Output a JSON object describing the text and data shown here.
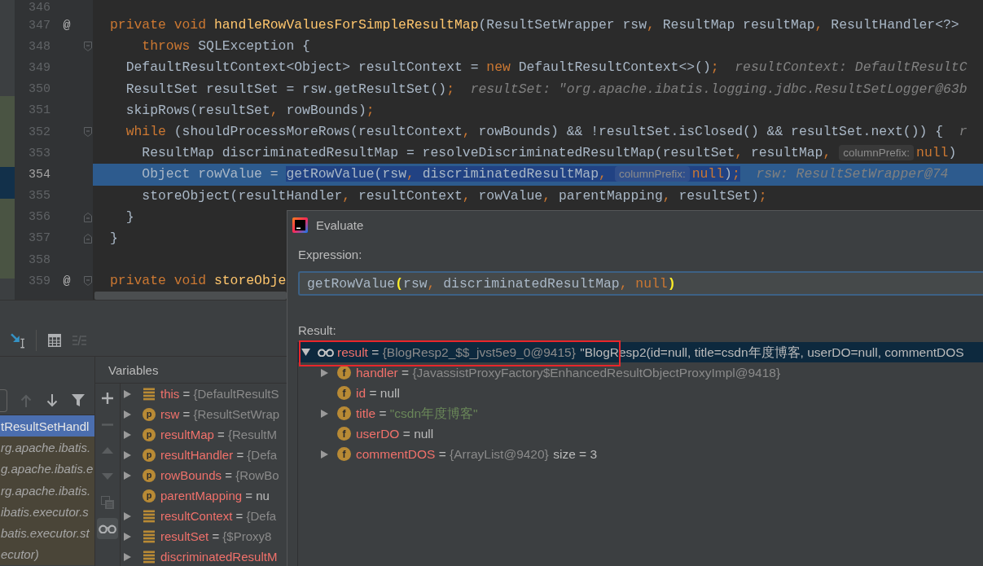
{
  "editor": {
    "lines": [
      {
        "number": "346",
        "current": false,
        "fold_start": false,
        "fold_end": false
      },
      {
        "number": "347",
        "gutter_mark": "@",
        "current": false,
        "fold_start": false,
        "fold_end": false,
        "tokens": [
          {
            "kind": "keyword",
            "text": "private void "
          },
          {
            "kind": "method",
            "text": "handleRowValuesForSimpleResultMap"
          },
          {
            "kind": "plain",
            "text": "(ResultSetWrapper rsw"
          },
          {
            "kind": "punct",
            "text": ","
          },
          {
            "kind": "plain",
            "text": " ResultMap resultMap"
          },
          {
            "kind": "punct",
            "text": ","
          },
          {
            "kind": "plain",
            "text": " ResultHandler<?>"
          }
        ]
      },
      {
        "number": "348",
        "current": false,
        "fold_start": true,
        "fold_end": false,
        "tokens": [
          {
            "kind": "keyword",
            "text": "    throws"
          },
          {
            "kind": "plain",
            "text": " SQLException {"
          }
        ]
      },
      {
        "number": "349",
        "current": false,
        "fold_start": false,
        "fold_end": false,
        "tokens": [
          {
            "kind": "plain",
            "text": "  DefaultResultContext<Object> resultContext = "
          },
          {
            "kind": "keyword",
            "text": "new"
          },
          {
            "kind": "plain",
            "text": " DefaultResultContext<>()"
          },
          {
            "kind": "punct",
            "text": ";"
          },
          {
            "kind": "hint",
            "text": "resultContext: DefaultResultC"
          }
        ]
      },
      {
        "number": "350",
        "current": false,
        "fold_start": false,
        "fold_end": false,
        "tokens": [
          {
            "kind": "plain",
            "text": "  ResultSet resultSet = rsw.getResultSet()"
          },
          {
            "kind": "punct",
            "text": ";"
          },
          {
            "kind": "hint",
            "text": "resultSet: \"org.apache.ibatis.logging.jdbc.ResultSetLogger@63b"
          }
        ]
      },
      {
        "number": "351",
        "current": false,
        "fold_start": false,
        "fold_end": false,
        "tokens": [
          {
            "kind": "plain",
            "text": "  skipRows(resultSet"
          },
          {
            "kind": "punct",
            "text": ","
          },
          {
            "kind": "plain",
            "text": " rowBounds)"
          },
          {
            "kind": "punct",
            "text": ";"
          }
        ]
      },
      {
        "number": "352",
        "current": false,
        "fold_start": true,
        "fold_end": false,
        "tokens": [
          {
            "kind": "keyword",
            "text": "  while"
          },
          {
            "kind": "plain",
            "text": " (shouldProcessMoreRows(resultContext"
          },
          {
            "kind": "punct",
            "text": ","
          },
          {
            "kind": "plain",
            "text": " rowBounds) && !resultSet.isClosed() && resultSet.next()) {"
          },
          {
            "kind": "hint",
            "text": "r"
          }
        ]
      },
      {
        "number": "353",
        "current": false,
        "fold_start": false,
        "fold_end": false,
        "tokens": [
          {
            "kind": "plain",
            "text": "    ResultMap discriminatedResultMap = resolveDiscriminatedResultMap(resultSet"
          },
          {
            "kind": "punct",
            "text": ","
          },
          {
            "kind": "plain",
            "text": " resultMap"
          },
          {
            "kind": "punct",
            "text": ","
          },
          {
            "kind": "inlay",
            "text": "columnPrefix:"
          },
          {
            "kind": "keyword",
            "text": "null"
          },
          {
            "kind": "plain",
            "text": ")"
          }
        ]
      },
      {
        "number": "354",
        "current": true,
        "fold_start": false,
        "fold_end": false,
        "tokens": [
          {
            "kind": "plain",
            "text": "    Object rowValue = "
          },
          {
            "kind": "selection",
            "tokens": [
              {
                "kind": "plain",
                "text": "getRowValue(rsw"
              },
              {
                "kind": "punct",
                "text": ","
              },
              {
                "kind": "plain",
                "text": " discriminatedResultMap"
              },
              {
                "kind": "punct",
                "text": ","
              },
              {
                "kind": "inlay",
                "text": "columnPrefix:"
              },
              {
                "kind": "keyword",
                "text": "null"
              },
              {
                "kind": "plain",
                "text": ")"
              },
              {
                "kind": "punct",
                "text": ";"
              }
            ]
          },
          {
            "kind": "hint",
            "text": "rsw: ResultSetWrapper@74"
          }
        ]
      },
      {
        "number": "355",
        "current": false,
        "fold_start": false,
        "fold_end": false,
        "tokens": [
          {
            "kind": "plain",
            "text": "    storeObject(resultHandler"
          },
          {
            "kind": "punct",
            "text": ","
          },
          {
            "kind": "plain",
            "text": " resultContext"
          },
          {
            "kind": "punct",
            "text": ","
          },
          {
            "kind": "plain",
            "text": " rowValue"
          },
          {
            "kind": "punct",
            "text": ","
          },
          {
            "kind": "plain",
            "text": " parentMapping"
          },
          {
            "kind": "punct",
            "text": ","
          },
          {
            "kind": "plain",
            "text": " resultSet)"
          },
          {
            "kind": "punct",
            "text": ";"
          }
        ]
      },
      {
        "number": "356",
        "current": false,
        "fold_start": false,
        "fold_end": true,
        "tokens": [
          {
            "kind": "plain",
            "text": "  }"
          }
        ]
      },
      {
        "number": "357",
        "current": false,
        "fold_start": false,
        "fold_end": true,
        "tokens": [
          {
            "kind": "plain",
            "text": "}"
          }
        ]
      },
      {
        "number": "358",
        "current": false,
        "fold_start": false,
        "fold_end": false
      },
      {
        "number": "359",
        "gutter_mark": "@",
        "current": false,
        "fold_start": true,
        "fold_end": false,
        "tokens": [
          {
            "kind": "keyword",
            "text": "private void "
          },
          {
            "kind": "method",
            "text": "storeObje"
          }
        ]
      }
    ]
  },
  "debug_panel": {
    "toolbar_groups": [
      {
        "buttons": [
          {
            "kind": "run_to_cursor",
            "disabled": false
          }
        ]
      },
      {
        "buttons": [
          {
            "kind": "evaluate",
            "disabled": false
          },
          {
            "kind": "trace",
            "disabled": true
          }
        ]
      }
    ],
    "frames_toolbar": [
      {
        "kind": "dropdown",
        "disabled": false
      },
      {
        "kind": "up",
        "disabled": true
      },
      {
        "kind": "down",
        "disabled": false
      },
      {
        "kind": "filter",
        "disabled": false
      }
    ],
    "frames": [
      {
        "text": "tResultSetHandl",
        "selected": true,
        "library": false
      },
      {
        "text": "rg.apache.ibatis.",
        "selected": false,
        "library": true
      },
      {
        "text": "g.apache.ibatis.e",
        "selected": false,
        "library": true
      },
      {
        "text": "rg.apache.ibatis.",
        "selected": false,
        "library": true
      },
      {
        "text": "ibatis.executor.s",
        "selected": false,
        "library": true
      },
      {
        "text": "batis.executor.st",
        "selected": false,
        "library": true
      },
      {
        "text": "ecutor)",
        "selected": false,
        "library": true
      }
    ],
    "variables_title": "Variables",
    "variables_toolbar": [
      {
        "kind": "add",
        "disabled": false,
        "on": false
      },
      {
        "kind": "remove",
        "disabled": true,
        "on": false
      },
      {
        "kind": "move_up",
        "disabled": true,
        "on": false
      },
      {
        "kind": "move_down",
        "disabled": true,
        "on": false
      },
      {
        "kind": "copy",
        "disabled": true,
        "on": false
      },
      {
        "kind": "watches",
        "disabled": false,
        "on": true
      }
    ],
    "variables": [
      {
        "kind": "object",
        "name": "this",
        "eq": "=",
        "value": {
          "kind": "object",
          "text": "{DefaultResultS"
        },
        "expandable": true,
        "expanded": false,
        "selected": false
      },
      {
        "kind": "param",
        "letter": "p",
        "name": "rsw",
        "eq": "=",
        "value": {
          "kind": "object",
          "text": "{ResultSetWrap"
        },
        "expandable": true,
        "expanded": false,
        "selected": false
      },
      {
        "kind": "param",
        "letter": "p",
        "name": "resultMap",
        "eq": "=",
        "value": {
          "kind": "object",
          "text": "{ResultM"
        },
        "expandable": true,
        "expanded": false,
        "selected": false
      },
      {
        "kind": "param",
        "letter": "p",
        "name": "resultHandler",
        "eq": "=",
        "value": {
          "kind": "object",
          "text": "{Defa"
        },
        "expandable": true,
        "expanded": false,
        "selected": false
      },
      {
        "kind": "param",
        "letter": "p",
        "name": "rowBounds",
        "eq": "=",
        "value": {
          "kind": "object",
          "text": "{RowBo"
        },
        "expandable": true,
        "expanded": false,
        "selected": false
      },
      {
        "kind": "param",
        "letter": "p",
        "name": "parentMapping",
        "eq": "=",
        "value": {
          "kind": "null",
          "text": "nu"
        },
        "expandable": false,
        "expanded": false,
        "selected": false
      },
      {
        "kind": "object",
        "name": "resultContext",
        "eq": "=",
        "value": {
          "kind": "object",
          "text": "{Defa"
        },
        "expandable": true,
        "expanded": false,
        "selected": false
      },
      {
        "kind": "object",
        "name": "resultSet",
        "eq": "=",
        "value": {
          "kind": "object",
          "text": "{$Proxy8"
        },
        "expandable": true,
        "expanded": false,
        "selected": false
      },
      {
        "kind": "object",
        "name": "discriminatedResultM",
        "expandable": true,
        "expanded": false,
        "selected": false
      }
    ]
  },
  "evaluate_dialog": {
    "title": "Evaluate",
    "expression_field": {
      "label": "Expression:",
      "value": [
        {
          "kind": "plain",
          "text": "getRowValue"
        },
        {
          "kind": "brace",
          "text": "("
        },
        {
          "kind": "plain",
          "text": "rsw"
        },
        {
          "kind": "punct",
          "text": ","
        },
        {
          "kind": "plain",
          "text": " discriminatedResultMap"
        },
        {
          "kind": "punct",
          "text": ","
        },
        {
          "kind": "keyword",
          "text": " null"
        },
        {
          "kind": "brace",
          "text": ")"
        }
      ]
    },
    "result_label": "Result:",
    "result": {
      "kind": "watch",
      "name": "result",
      "eq": "=",
      "value": {
        "kind": "object",
        "text": "{BlogResp2_$$_jvst5e9_0@9415}"
      },
      "to_string": "\"BlogResp2(id=null, title=csdn年度博客, userDO=null, commentDOS",
      "expandable": true,
      "expanded": true,
      "selected": true,
      "framed": true,
      "children": [
        {
          "kind": "field",
          "letter": "f",
          "name": "handler",
          "eq": "=",
          "value": {
            "kind": "object",
            "text": "{JavassistProxyFactory$EnhancedResultObjectProxyImpl@9418}"
          },
          "expandable": true,
          "expanded": false,
          "selected": false,
          "framed": false
        },
        {
          "kind": "field",
          "letter": "f",
          "name": "id",
          "eq": "=",
          "value": {
            "kind": "null",
            "text": "null"
          },
          "expandable": false,
          "expanded": false,
          "selected": false,
          "framed": false
        },
        {
          "kind": "field",
          "letter": "f",
          "name": "title",
          "eq": "=",
          "value": {
            "kind": "string",
            "text": "\"csdn年度博客\""
          },
          "expandable": true,
          "expanded": false,
          "selected": false,
          "framed": false
        },
        {
          "kind": "field",
          "letter": "f",
          "name": "userDO",
          "eq": "=",
          "value": {
            "kind": "null",
            "text": "null"
          },
          "expandable": false,
          "expanded": false,
          "selected": false,
          "framed": false
        },
        {
          "kind": "field",
          "letter": "f",
          "name": "commentDOS",
          "eq": "=",
          "value": {
            "kind": "object",
            "text": "{ArrayList@9420}"
          },
          "extra": "size = 3",
          "expandable": true,
          "expanded": false,
          "selected": false,
          "framed": false
        }
      ]
    }
  }
}
